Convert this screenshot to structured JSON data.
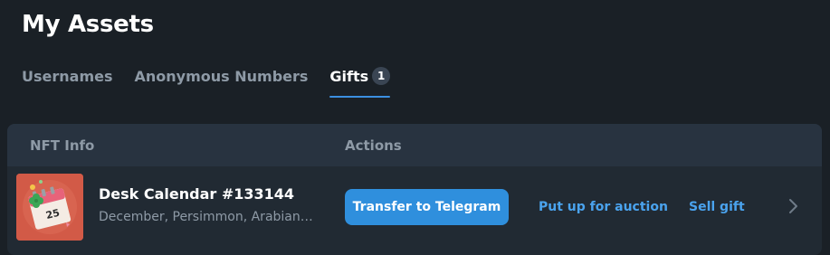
{
  "page": {
    "title": "My Assets"
  },
  "tabs": [
    {
      "label": "Usernames",
      "active": false
    },
    {
      "label": "Anonymous Numbers",
      "active": false
    },
    {
      "label": "Gifts",
      "active": true,
      "count": "1"
    }
  ],
  "table": {
    "headers": {
      "nft_info": "NFT Info",
      "actions": "Actions"
    },
    "rows": [
      {
        "title": "Desk Calendar #133144",
        "subtitle": "December, Persimmon, Arabian ...",
        "thumbnail": {
          "icon": "desk-calendar-icon",
          "date_text": "25",
          "background": "#d25a47"
        },
        "actions": {
          "transfer": "Transfer to Telegram",
          "auction": "Put up for auction",
          "sell": "Sell gift"
        }
      }
    ]
  },
  "colors": {
    "background": "#1a2026",
    "panel": "#212a33",
    "panel_header": "#283340",
    "accent": "#2f8fdd",
    "link": "#4aa3ee",
    "muted_text": "#8e9aa6"
  }
}
